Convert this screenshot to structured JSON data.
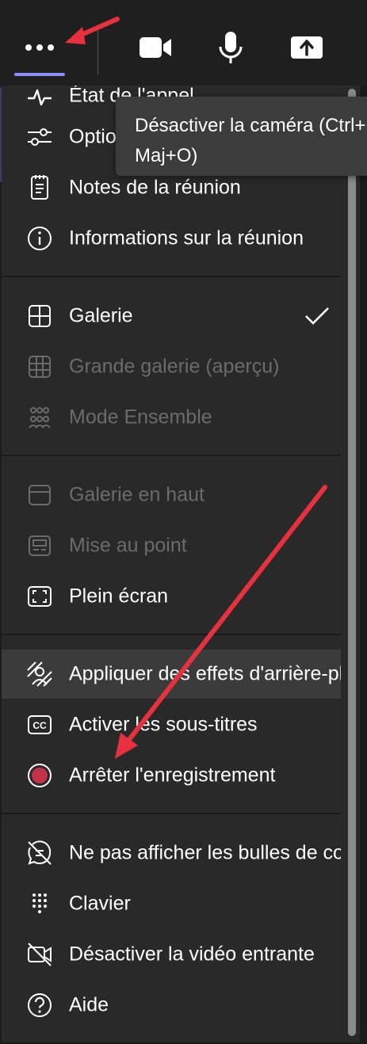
{
  "toolbar": {
    "more_icon": "more-dots-icon",
    "camera_icon": "video-camera-icon",
    "mic_icon": "microphone-icon",
    "share_icon": "share-upload-icon",
    "accent": "#8b8cf5"
  },
  "tooltip": {
    "text": "Désactiver la caméra (Ctrl+Maj+O)"
  },
  "menu": {
    "items": [
      {
        "label": "État de l'appel",
        "icon": "call-health-icon"
      },
      {
        "label": "Options",
        "icon": "options-sliders-icon"
      },
      {
        "label": "Notes de la réunion",
        "icon": "notes-icon"
      },
      {
        "label": "Informations sur la réunion",
        "icon": "info-icon"
      },
      {
        "label": "Galerie",
        "icon": "gallery-grid-icon",
        "checked": true
      },
      {
        "label": "Grande galerie (aperçu)",
        "icon": "large-gallery-icon",
        "disabled": true
      },
      {
        "label": "Mode Ensemble",
        "icon": "together-mode-icon",
        "disabled": true
      },
      {
        "label": "Galerie en haut",
        "icon": "gallery-top-icon",
        "disabled": true
      },
      {
        "label": "Mise au point",
        "icon": "focus-icon",
        "disabled": true
      },
      {
        "label": "Plein écran",
        "icon": "fullscreen-icon"
      },
      {
        "label": "Appliquer des effets d'arrière-plan",
        "icon": "background-effects-icon"
      },
      {
        "label": "Activer les sous-titres",
        "icon": "captions-cc-icon"
      },
      {
        "label": "Arrêter l'enregistrement",
        "icon": "record-stop-icon",
        "record_color": "#c4314b"
      },
      {
        "label": "Ne pas afficher les bulles de conversation",
        "icon": "no-chat-bubbles-icon"
      },
      {
        "label": "Clavier",
        "icon": "keypad-icon"
      },
      {
        "label": "Désactiver la vidéo entrante",
        "icon": "video-off-icon"
      },
      {
        "label": "Aide",
        "icon": "help-icon"
      }
    ]
  },
  "annotations": {
    "arrow_color": "#e8313f"
  }
}
